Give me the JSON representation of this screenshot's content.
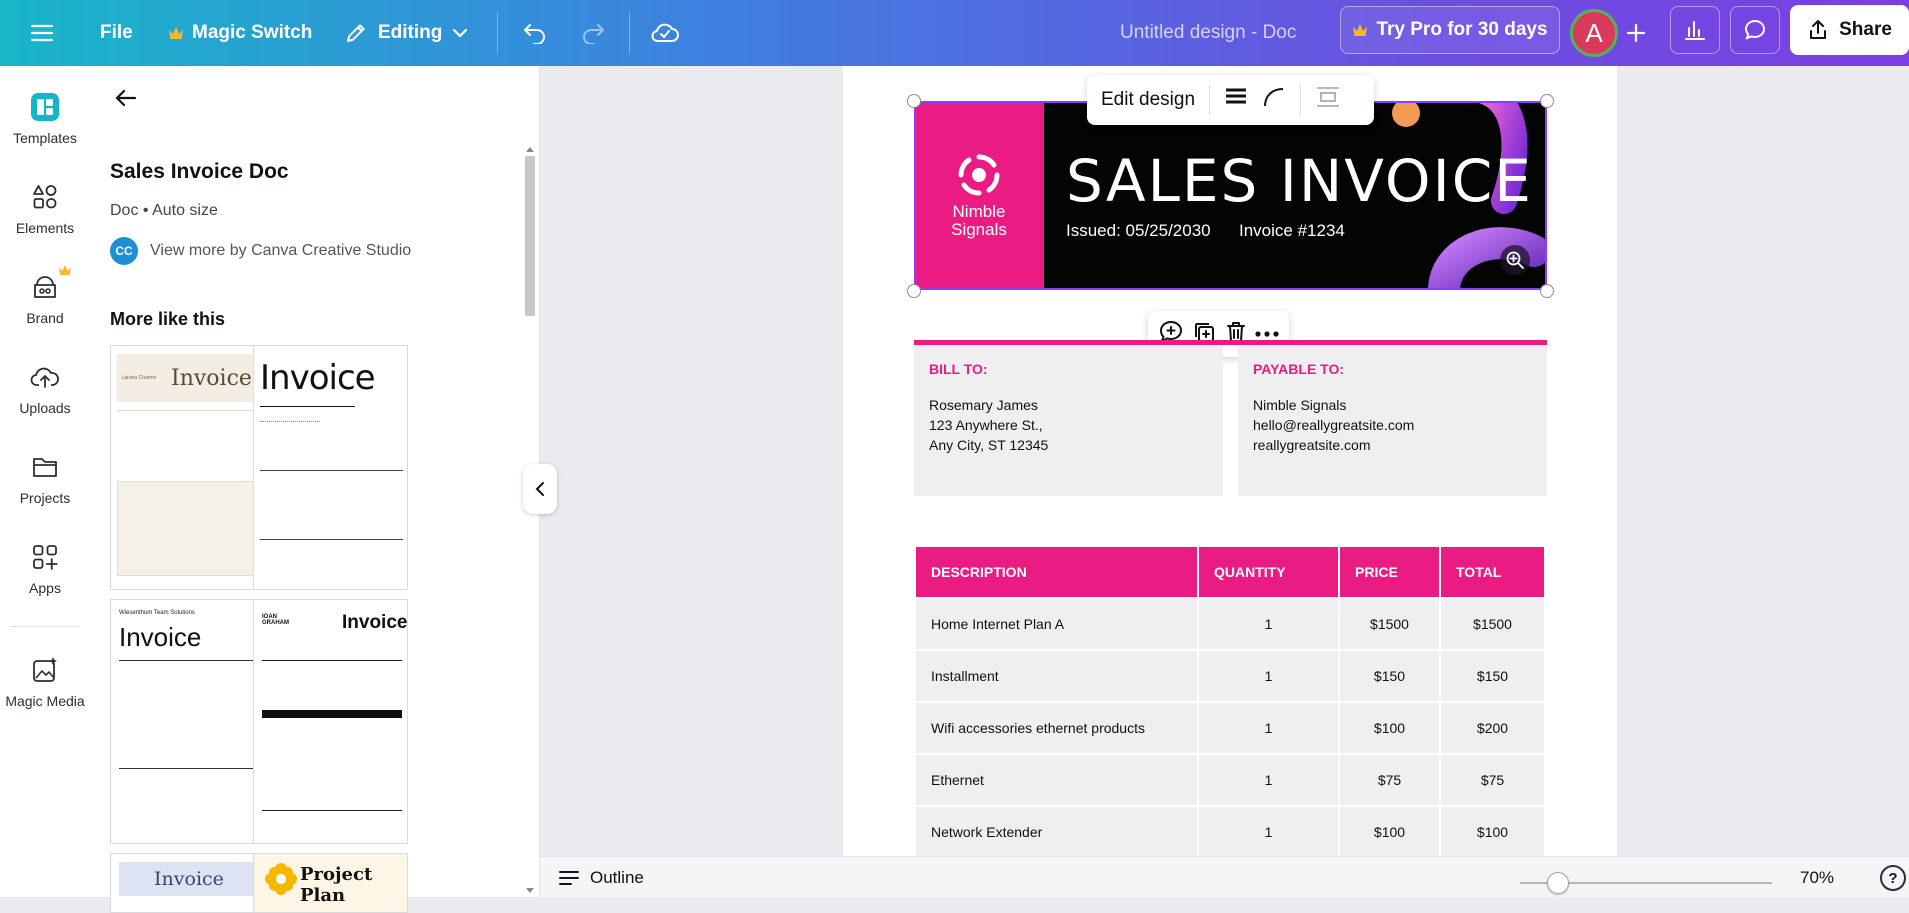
{
  "topbar": {
    "file_label": "File",
    "magic_switch_label": "Magic Switch",
    "editing_label": "Editing",
    "title": "Untitled design - Doc",
    "pro_label": "Try Pro for 30 days",
    "avatar_initial": "A",
    "share_label": "Share"
  },
  "rail": {
    "items": [
      {
        "label": "Templates",
        "icon": "templates-icon"
      },
      {
        "label": "Elements",
        "icon": "elements-icon"
      },
      {
        "label": "Brand",
        "icon": "brand-icon"
      },
      {
        "label": "Uploads",
        "icon": "uploads-icon"
      },
      {
        "label": "Projects",
        "icon": "projects-icon"
      },
      {
        "label": "Apps",
        "icon": "apps-icon"
      },
      {
        "label": "Magic Media",
        "icon": "magic-media-icon"
      }
    ]
  },
  "panel": {
    "template_title": "Sales Invoice Doc",
    "meta": "Doc • Auto size",
    "creator_initials": "CC",
    "creator_link": "View more by Canva Creative Studio",
    "more_title": "More like this",
    "thumbs": [
      {
        "title": "Invoice",
        "brand": "Larana Charme"
      },
      {
        "title": "Invoice",
        "brand": ""
      },
      {
        "title": "Invoice",
        "brand": "Wiesenthum Team Solutions"
      },
      {
        "title": "Invoice",
        "brand": "IOAN GRAHAM"
      },
      {
        "title": "Invoice",
        "brand": ""
      },
      {
        "title": "Project Plan",
        "brand": ""
      }
    ]
  },
  "canvas": {
    "edit_design_label": "Edit design",
    "banner": {
      "brand_line1": "Nimble",
      "brand_line2": "Signals",
      "title": "SALES INVOICE",
      "issued": "Issued: 05/25/2030",
      "invoice_no": "Invoice #1234"
    },
    "bill_to": {
      "heading": "BILL TO:",
      "lines": [
        "Rosemary James",
        "123 Anywhere St.,",
        "Any City, ST 12345"
      ]
    },
    "payable_to": {
      "heading": "PAYABLE TO:",
      "lines": [
        "Nimble Signals",
        "hello@reallygreatsite.com",
        "reallygreatsite.com"
      ]
    },
    "table": {
      "headers": [
        "DESCRIPTION",
        "QUANTITY",
        "PRICE",
        "TOTAL"
      ],
      "rows": [
        [
          "Home Internet Plan A",
          "1",
          "$1500",
          "$1500"
        ],
        [
          "Installment",
          "1",
          "$150",
          "$150"
        ],
        [
          "Wifi accessories ethernet products",
          "1",
          "$100",
          "$200"
        ],
        [
          "Ethernet",
          "1",
          "$75",
          "$75"
        ],
        [
          "Network Extender",
          "1",
          "$100",
          "$100"
        ]
      ]
    }
  },
  "bottombar": {
    "outline_label": "Outline",
    "zoom_label": "70%",
    "zoom_level": 0.15,
    "help_label": "?"
  },
  "colors": {
    "accent_pink": "#ea1b83",
    "selection_purple": "#8b3dff",
    "banner_black": "#050405"
  }
}
